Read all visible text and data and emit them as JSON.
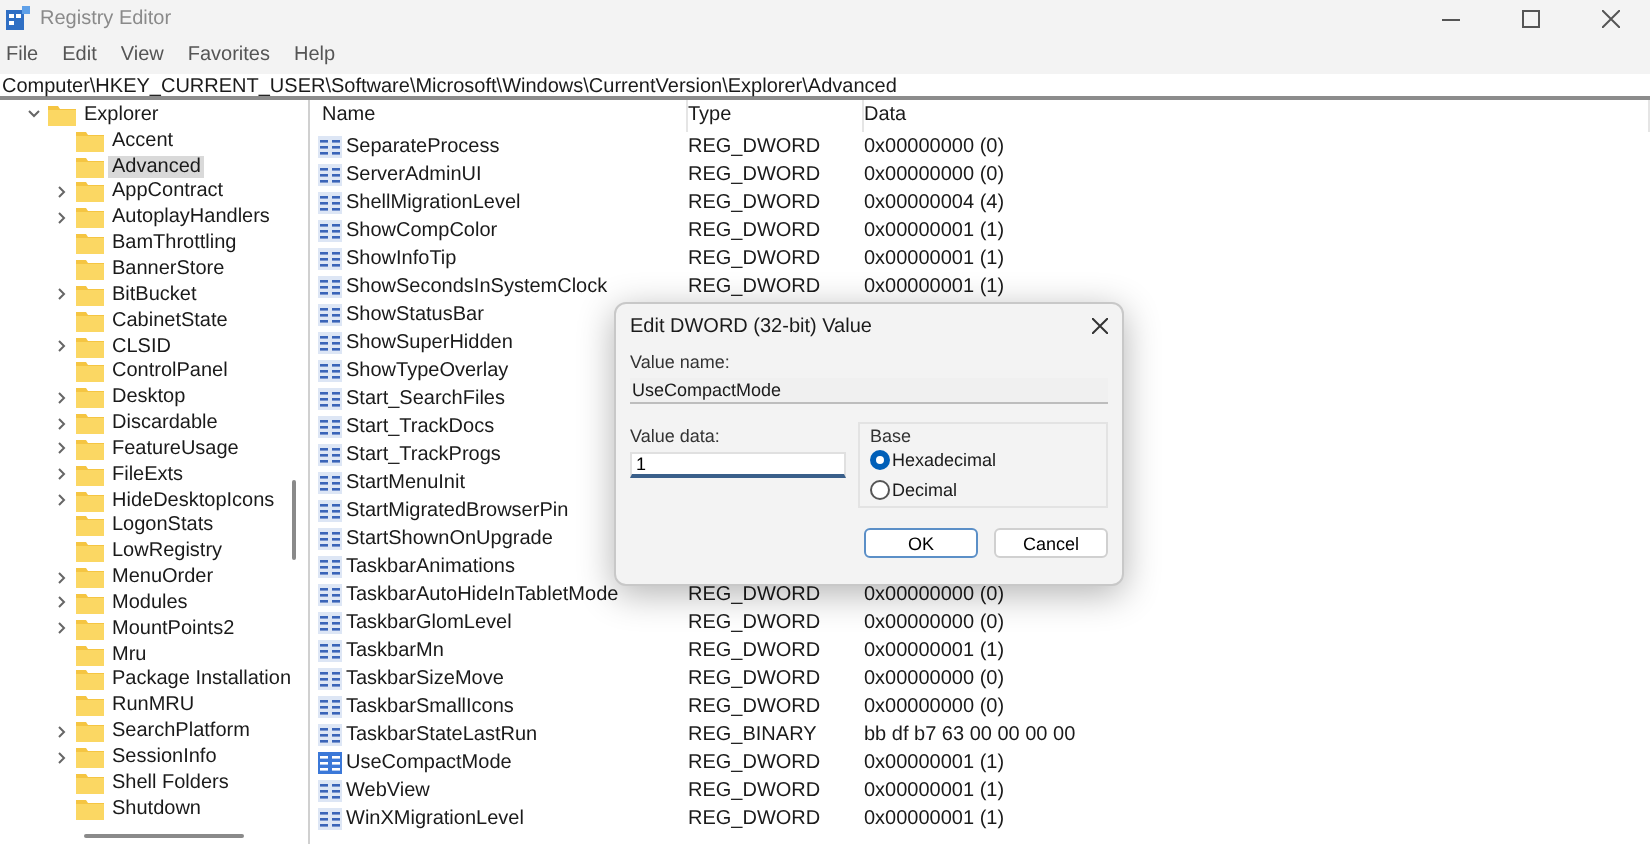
{
  "window": {
    "title": "Registry Editor"
  },
  "menu": [
    "File",
    "Edit",
    "View",
    "Favorites",
    "Help"
  ],
  "address": "Computer\\HKEY_CURRENT_USER\\Software\\Microsoft\\Windows\\CurrentVersion\\Explorer\\Advanced",
  "tree": [
    {
      "label": "Explorer",
      "expanded": true,
      "selected": false,
      "children": [
        {
          "label": "Accent",
          "expandable": false,
          "selected": false
        },
        {
          "label": "Advanced",
          "expandable": false,
          "selected": true
        },
        {
          "label": "AppContract",
          "expandable": true,
          "selected": false
        },
        {
          "label": "AutoplayHandlers",
          "expandable": true,
          "selected": false
        },
        {
          "label": "BamThrottling",
          "expandable": false,
          "selected": false
        },
        {
          "label": "BannerStore",
          "expandable": false,
          "selected": false
        },
        {
          "label": "BitBucket",
          "expandable": true,
          "selected": false
        },
        {
          "label": "CabinetState",
          "expandable": false,
          "selected": false
        },
        {
          "label": "CLSID",
          "expandable": true,
          "selected": false
        },
        {
          "label": "ControlPanel",
          "expandable": false,
          "selected": false
        },
        {
          "label": "Desktop",
          "expandable": true,
          "selected": false
        },
        {
          "label": "Discardable",
          "expandable": true,
          "selected": false
        },
        {
          "label": "FeatureUsage",
          "expandable": true,
          "selected": false
        },
        {
          "label": "FileExts",
          "expandable": true,
          "selected": false
        },
        {
          "label": "HideDesktopIcons",
          "expandable": true,
          "selected": false
        },
        {
          "label": "LogonStats",
          "expandable": false,
          "selected": false
        },
        {
          "label": "LowRegistry",
          "expandable": false,
          "selected": false
        },
        {
          "label": "MenuOrder",
          "expandable": true,
          "selected": false
        },
        {
          "label": "Modules",
          "expandable": true,
          "selected": false
        },
        {
          "label": "MountPoints2",
          "expandable": true,
          "selected": false
        },
        {
          "label": "Mru",
          "expandable": false,
          "selected": false
        },
        {
          "label": "Package Installation",
          "expandable": false,
          "selected": false
        },
        {
          "label": "RunMRU",
          "expandable": false,
          "selected": false
        },
        {
          "label": "SearchPlatform",
          "expandable": true,
          "selected": false
        },
        {
          "label": "SessionInfo",
          "expandable": true,
          "selected": false
        },
        {
          "label": "Shell Folders",
          "expandable": false,
          "selected": false
        },
        {
          "label": "Shutdown",
          "expandable": false,
          "selected": false
        }
      ]
    }
  ],
  "values": {
    "columns": [
      "Name",
      "Type",
      "Data"
    ],
    "rows": [
      {
        "name": "SeparateProcess",
        "type": "REG_DWORD",
        "data": "0x00000000 (0)",
        "selected": false
      },
      {
        "name": "ServerAdminUI",
        "type": "REG_DWORD",
        "data": "0x00000000 (0)",
        "selected": false
      },
      {
        "name": "ShellMigrationLevel",
        "type": "REG_DWORD",
        "data": "0x00000004 (4)",
        "selected": false
      },
      {
        "name": "ShowCompColor",
        "type": "REG_DWORD",
        "data": "0x00000001 (1)",
        "selected": false
      },
      {
        "name": "ShowInfoTip",
        "type": "REG_DWORD",
        "data": "0x00000001 (1)",
        "selected": false
      },
      {
        "name": "ShowSecondsInSystemClock",
        "type": "REG_DWORD",
        "data": "0x00000001 (1)",
        "selected": false
      },
      {
        "name": "ShowStatusBar",
        "selected": false
      },
      {
        "name": "ShowSuperHidden",
        "selected": false
      },
      {
        "name": "ShowTypeOverlay",
        "selected": false
      },
      {
        "name": "Start_SearchFiles",
        "selected": false
      },
      {
        "name": "Start_TrackDocs",
        "selected": false
      },
      {
        "name": "Start_TrackProgs",
        "selected": false
      },
      {
        "name": "StartMenuInit",
        "selected": false
      },
      {
        "name": "StartMigratedBrowserPin",
        "selected": false
      },
      {
        "name": "StartShownOnUpgrade",
        "selected": false
      },
      {
        "name": "TaskbarAnimations",
        "selected": false
      },
      {
        "name": "TaskbarAutoHideInTabletMode",
        "type": "REG_DWORD",
        "data": "0x00000000 (0)",
        "selected": false
      },
      {
        "name": "TaskbarGlomLevel",
        "type": "REG_DWORD",
        "data": "0x00000000 (0)",
        "selected": false
      },
      {
        "name": "TaskbarMn",
        "type": "REG_DWORD",
        "data": "0x00000001 (1)",
        "selected": false
      },
      {
        "name": "TaskbarSizeMove",
        "type": "REG_DWORD",
        "data": "0x00000000 (0)",
        "selected": false
      },
      {
        "name": "TaskbarSmallIcons",
        "type": "REG_DWORD",
        "data": "0x00000000 (0)",
        "selected": false
      },
      {
        "name": "TaskbarStateLastRun",
        "type": "REG_BINARY",
        "data": "bb df b7 63 00 00 00 00",
        "selected": false
      },
      {
        "name": "UseCompactMode",
        "type": "REG_DWORD",
        "data": "0x00000001 (1)",
        "selected": true
      },
      {
        "name": "WebView",
        "type": "REG_DWORD",
        "data": "0x00000001 (1)",
        "selected": false
      },
      {
        "name": "WinXMigrationLevel",
        "type": "REG_DWORD",
        "data": "0x00000001 (1)",
        "selected": false
      }
    ]
  },
  "dialog": {
    "title": "Edit DWORD (32-bit) Value",
    "value_name_label": "Value name:",
    "value_name": "UseCompactMode",
    "value_data_label": "Value data:",
    "value_data": "1",
    "base_label": "Base",
    "bases": [
      {
        "label": "Hexadecimal",
        "selected": true
      },
      {
        "label": "Decimal",
        "selected": false
      }
    ],
    "buttons": [
      {
        "label": "OK",
        "default": true
      },
      {
        "label": "Cancel",
        "default": false
      }
    ]
  }
}
